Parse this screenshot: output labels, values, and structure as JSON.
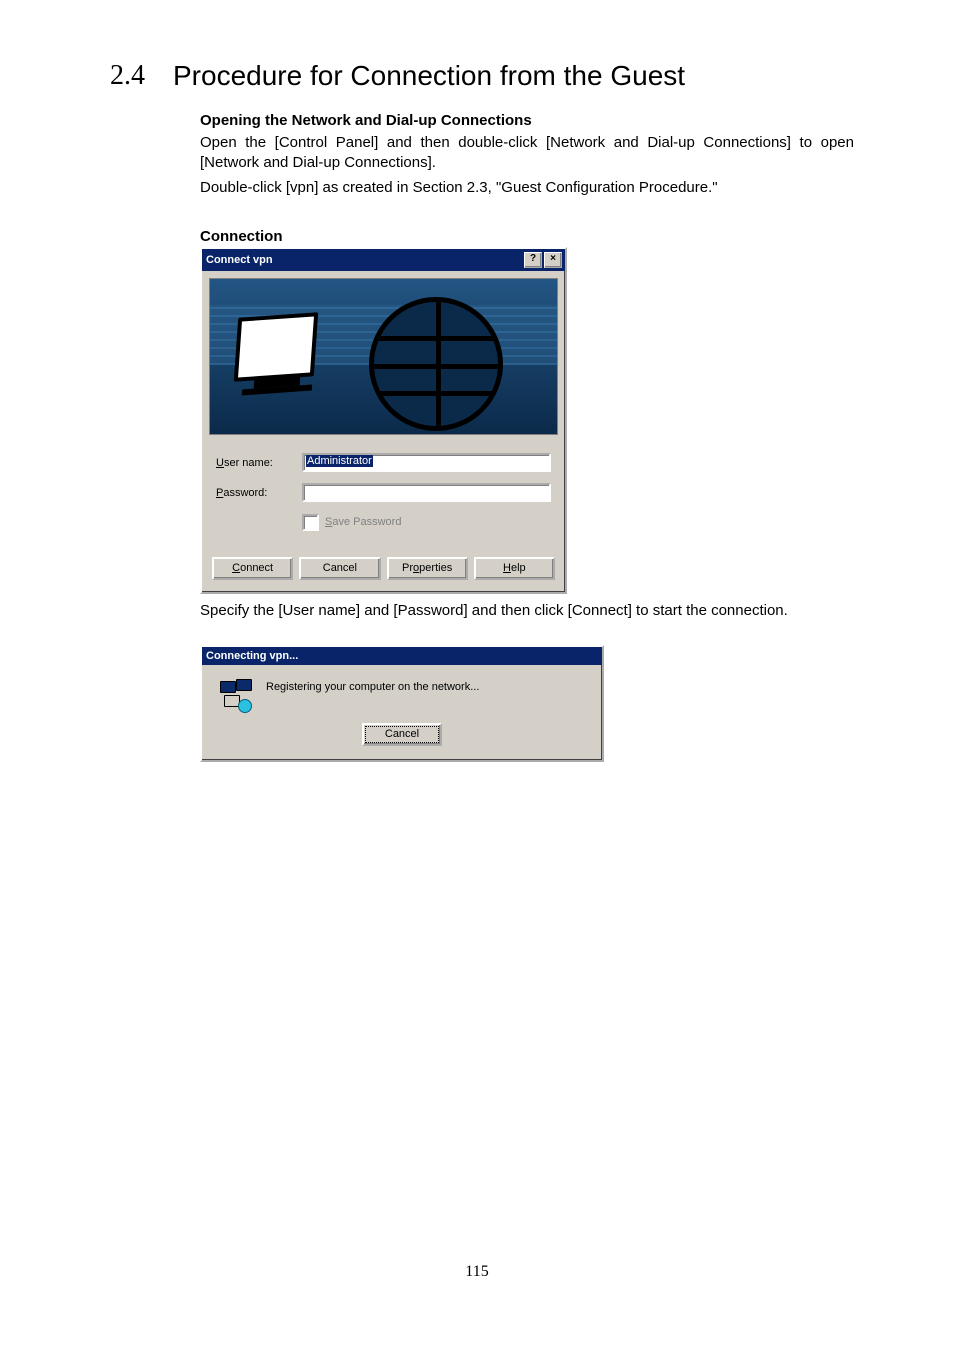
{
  "heading": {
    "number": "2.4",
    "title": "Procedure for Connection from the Guest"
  },
  "intro": {
    "subheading": "Opening the Network and Dial-up Connections",
    "line1": "Open the [Control Panel] and then double-click [Network and Dial-up Connections] to open [Network and Dial-up Connections].",
    "line2": "Double-click [vpn] as created in Section 2.3, \"Guest Configuration Procedure.\""
  },
  "dialog1": {
    "caption": "Connection",
    "title": "Connect vpn",
    "help_glyph": "?",
    "close_glyph": "×",
    "username_label_pre": "U",
    "username_label_rest": "ser name:",
    "username_value": "Administrator",
    "password_label_pre": "P",
    "password_label_rest": "assword:",
    "password_value": "",
    "save_password_pre": "S",
    "save_password_rest": "ave Password",
    "buttons": {
      "connect_pre": "C",
      "connect_rest": "onnect",
      "cancel": "Cancel",
      "properties_pre": "o",
      "properties_before": "Pr",
      "properties_after": "perties",
      "help_pre": "H",
      "help_rest": "elp"
    }
  },
  "after_dialog_text": "Specify the [User name] and [Password] and then click [Connect] to start the connection.",
  "dialog2": {
    "title": "Connecting vpn...",
    "message": "Registering your computer on the network...",
    "cancel": "Cancel"
  },
  "page_number": "115"
}
